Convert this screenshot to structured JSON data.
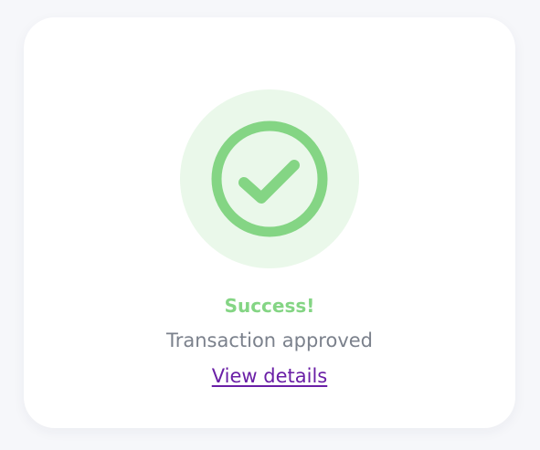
{
  "status": {
    "title": "Success!",
    "message": "Transaction approved",
    "link_label": "View details",
    "icon": "check-circle-icon"
  },
  "colors": {
    "success": "#84d584",
    "halo": "#eaf8ea",
    "link": "#6a1fa6",
    "muted": "#7b818c"
  }
}
